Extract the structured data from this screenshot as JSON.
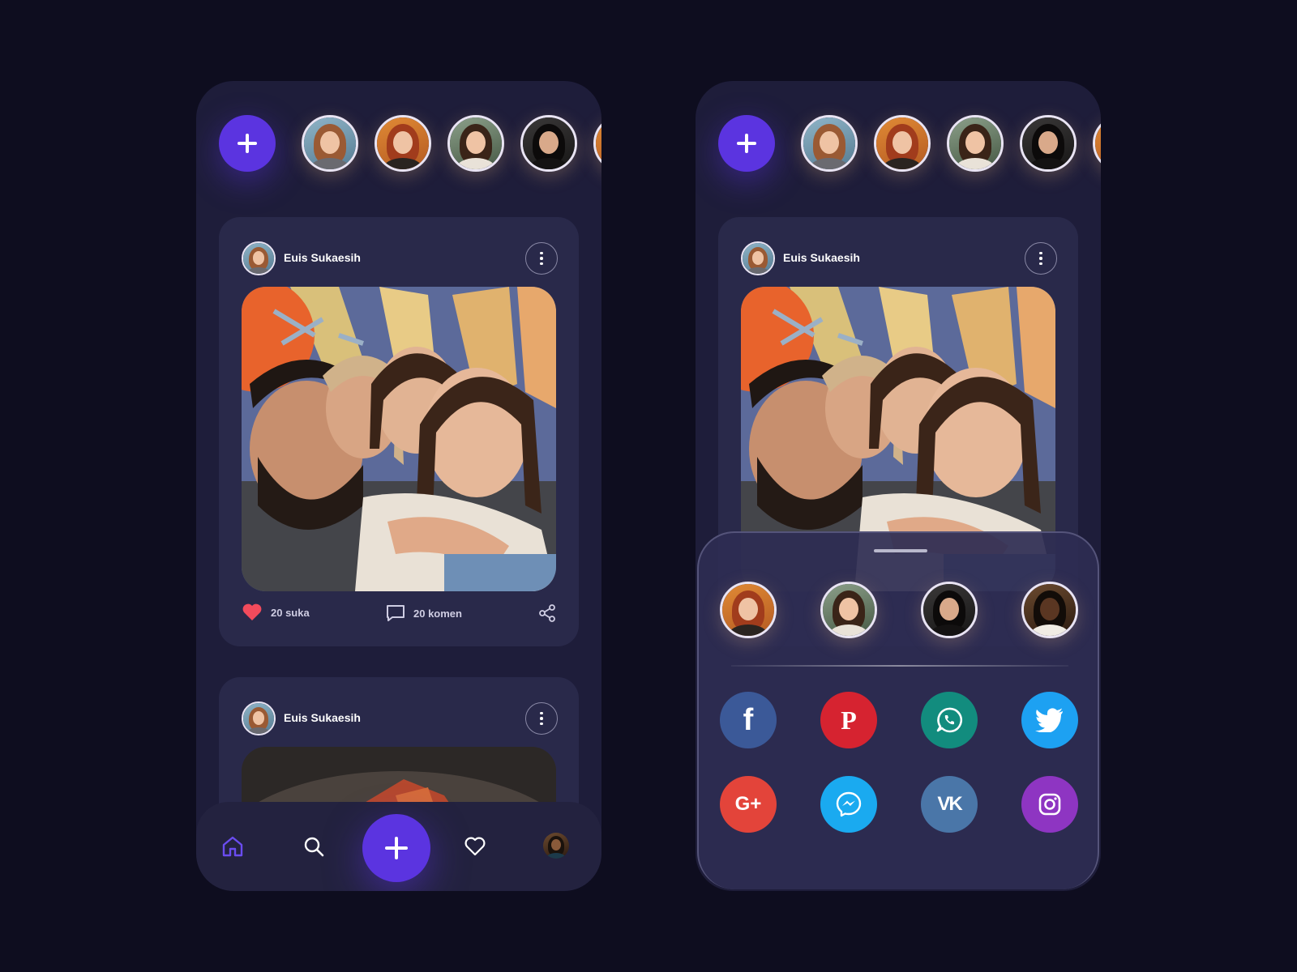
{
  "colors": {
    "background": "#0e0d1f",
    "phone": "#1e1d3a",
    "card": "#29294a",
    "accent": "#5b34e0",
    "like": "#f24b5c",
    "facebook": "#3b5998",
    "pinterest": "#d62330",
    "whatsapp": "#128c7e",
    "twitter": "#1da1f2",
    "google_plus": "#e3443a",
    "messenger": "#1aaaf0",
    "vk": "#4a76a8",
    "instagram": "#8e35c2"
  },
  "left_screen": {
    "posts": [
      {
        "author": "Euis Sukaesih",
        "likes": "20 suka",
        "comments": "20 komen"
      },
      {
        "author": "Euis Sukaesih"
      }
    ]
  },
  "right_screen": {
    "post": {
      "author": "Euis Sukaesih"
    },
    "share_targets": [
      "facebook-icon",
      "pinterest-icon",
      "whatsapp-icon",
      "twitter-icon",
      "google-plus-icon",
      "messenger-icon",
      "vk-icon",
      "instagram-icon"
    ],
    "social_glyphs": {
      "facebook": "f",
      "pinterest": "P",
      "google_plus": "G+",
      "vk": "VK"
    }
  },
  "bottom_nav": {
    "items": [
      "home-icon",
      "search-icon",
      "add-icon",
      "heart-icon",
      "profile-avatar"
    ],
    "active": "home-icon"
  }
}
